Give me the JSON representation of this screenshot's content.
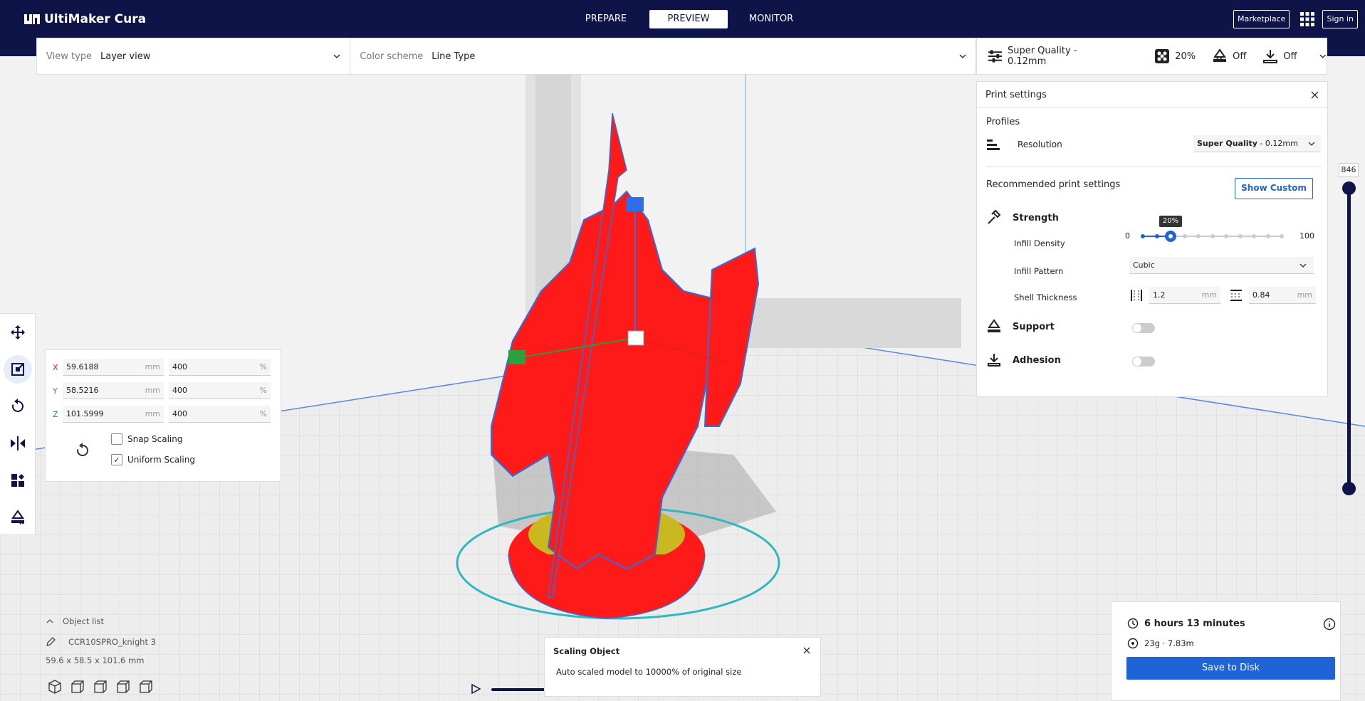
{
  "app": {
    "name": "UltiMaker Cura"
  },
  "stages": [
    "PREPARE",
    "PREVIEW",
    "MONITOR"
  ],
  "active_stage": "PREVIEW",
  "top_right": {
    "marketplace": "Marketplace",
    "signin": "Sign in"
  },
  "header": {
    "view_type_label": "View type",
    "view_type_value": "Layer view",
    "color_scheme_label": "Color scheme",
    "color_scheme_value": "Line Type"
  },
  "quick_settings": {
    "profile": "Super Quality - 0.12mm",
    "infill": "20%",
    "support": "Off",
    "adhesion": "Off"
  },
  "scale_tool": {
    "x": "59.6188",
    "y": "58.5216",
    "z": "101.5999",
    "x_pct": "400",
    "y_pct": "400",
    "z_pct": "400",
    "unit_mm": "mm",
    "unit_pct": "%",
    "axis_x": "X",
    "axis_y": "Y",
    "axis_z": "Z",
    "snap_scaling": "Snap Scaling",
    "uniform_scaling": "Uniform Scaling",
    "snap_checked": false,
    "uniform_checked": true
  },
  "print_settings": {
    "title": "Print settings",
    "profiles_label": "Profiles",
    "resolution_label": "Resolution",
    "resolution_bold": "Super Quality",
    "resolution_rest": " - 0.12mm",
    "recommended_label": "Recommended print settings",
    "show_custom": "Show Custom",
    "strength_label": "Strength",
    "infill_density_label": "Infill Density",
    "infill_min": "0",
    "infill_max": "100",
    "infill_value": 20,
    "infill_tooltip": "20%",
    "infill_pattern_label": "Infill Pattern",
    "infill_pattern_value": "Cubic",
    "shell_thickness_label": "Shell Thickness",
    "wall_value": "1.2",
    "topbottom_value": "0.84",
    "unit": "mm",
    "support_label": "Support",
    "support_on": false,
    "adhesion_label": "Adhesion",
    "adhesion_on": false
  },
  "layer_slider": {
    "value": "846"
  },
  "object_list": {
    "toggle_label": "Object list",
    "object_name": "CCR10SPRO_knight 3",
    "dimensions": "59.6 x 58.5 x 101.6 mm"
  },
  "message": {
    "title": "Scaling Object",
    "text": "Auto scaled model to 10000% of original size"
  },
  "estimate": {
    "time": "6 hours 13 minutes",
    "material": "23g · 7.83m",
    "save_button": "Save to Disk"
  },
  "colors": {
    "navbar": "#0f1448",
    "accent": "#1f63d6",
    "model": "#ff1a1a"
  }
}
